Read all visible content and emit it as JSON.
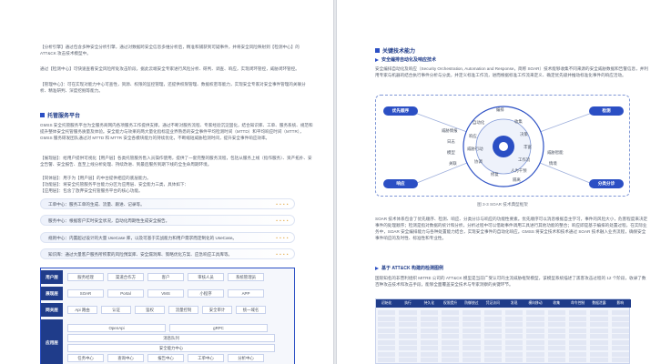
{
  "left": {
    "intro": [
      "【分析引擎】通过包含多种安全分析引擎，通过对数据跨安全信息多维分析后，精准和捕获到可疑事件，并将安全风险映射到【检测中心】的 ATT&CK 攻击技术模型中。",
      "通过【检测中心】可快速查看安全风险所处攻击阶段，据此云端安全专家进行风险分析、研判、调查、响应，实现闭环管控，威胁闭环管控。",
      "【管理中心】：可在实现对能力中心可查性，资源、权限的监控管理，还提供权限管理、数据权密等能力，实现安全专家对安全事件管理的关联分析、精准研判、深度挖掘等能力。"
    ],
    "section_title": "托管服务平台",
    "section_body": "GMSS 安全托管服务平台为全服务商网内各项服务工作提供支撑，通过不断对服务流程、专家经验沉淀固化，结合知识库、工单、服务系统、规范和提升整体安全托管服务质量及体验。安全能力与效果的两大量化指标是业界熟悉的安全事件平均检测时间（MTTD）和平均响应时间（MTTR），GMSS 服务研发团队通过对 MTTD 和 MTTR 安全各模块能力的持续优化，不断缩短威胁检测时间，提升安全事件响应效率。",
    "section_body2": "【展现层】：给用户提供可视化【用户层】各类托管服务售入员操作使用，提供了一套完整的服务流程，包括从服务上线（指作服务）、资产拓扑、安全告警、安全报告、直至上线分析处理、持续改进、到最后服务到期下线的全生命周期环境。",
    "section_body3": "【同体层】：用于为【用户层】的中台提供相应的底层能力。",
    "section_body4": "【功能层】：将安全托管服务平台能力分区为应用层、安全能力三类，具体如下：",
    "app_layer": "【应用层】：包含了放弃安全托管服务平台的核心功能。",
    "callouts": [
      "工单中心：服务工单的生成、流量、跟进、记录等。",
      "服务中心：根据客户实时安全状况，自动化周期性生成安全报告。",
      "规则中心：内置超过设计的大量 UseCase 库，以及可基于实战能力和用户需求而定制化的 UseCase。",
      "知识库：通过大量客户服务所积累的风险预案库、安全漏洞库、策略优化方案、应急响应工具库等。"
    ],
    "arch": {
      "rows": [
        {
          "label": "用户层",
          "cells": [
            "服务经理",
            "渠道合作方",
            "客户",
            "审核人员",
            "系统管理员"
          ]
        },
        {
          "label": "展现层",
          "cells": [
            "SOAR",
            "Portal",
            "VMS",
            "小程序",
            "APP"
          ]
        },
        {
          "label": "网关层",
          "cells": [
            "Api 路由",
            "认证",
            "鉴权",
            "流量控制",
            "安全审计",
            "统一域名"
          ]
        },
        {
          "label": "应用层",
          "cells": [
            "OpenApi",
            "gRPC",
            "消息队列",
            "安全能力中心",
            "任务中心",
            "查询中心",
            "报告中心",
            "工单中心",
            "分析中心"
          ]
        }
      ]
    }
  },
  "right": {
    "section_title": "关键技术能力",
    "sub1_title": "安全编排自动化及响应技术",
    "sub1_body": "安全编排自动化及响应（Security Orchestration, Automation and Response，简称 SOAR）技术能够收集不同来源的安全威胁数据和告警信息，并利用专家与机器的结合执行事件分析与分类，并定义标准工作流，进而根据标准工作流来定义、确定优先级并推动标准化事件的响应活动。",
    "diagram": {
      "buttons": {
        "tl": "优先顺序",
        "tr": "检测",
        "bl": "响应",
        "br": "分类分诊"
      },
      "ring": [
        "编排",
        "自动化",
        "响应",
        "威胁行动",
        "协调",
        "修复",
        "隔离"
      ],
      "right_words": [
        "收集",
        "决策",
        "丰富",
        "工作流",
        "人为干预",
        "威胁智能",
        "情境"
      ],
      "left_words": [
        "威胁情报",
        "日志",
        "模型",
        "关联"
      ],
      "caption": "图 3-3 SOAR 技术典型框架"
    },
    "after_body": "SOAR 技术体系包含了优先顺序、检测、响应、分类分诊与响应的功能性要素。优先顺序可以消息根据自主学习，事件的风险大小，危害程度来决定事件的处理顺序；检测是指对数据的统计和分析，分析过程中可以借助事件调用工具进行其他功能的整合；响应即是基于编排的处置过程，在实际业务中，SOAR 安全编排能力与各种处置能力结合，实现安全事件的自动化响应。GMSS 将安全技术和技术通过 SOAR 技术融入业务流程，确保安全事件响应的及时性、标准性和专业性。",
    "sub2_title": "基于 ATT&CK 构建的检测图例",
    "sub2_body": "国际知名的非营利组织 MITRE 公司的 ATT&CK 模型是当前广受认可的主流威胁框架模型，该模型系统描述了黑客攻击过程的 12 个阶段，收录了数百种攻击技术和攻击手段，能够全面覆盖安全技术与专家洞察的关键环节。",
    "matrix_headers": [
      "初始化",
      "执行",
      "持久化",
      "权限提升",
      "防御绕过",
      "凭证访问",
      "发现",
      "横向移动",
      "收集",
      "命令控制",
      "数据泄露",
      "影响"
    ]
  }
}
